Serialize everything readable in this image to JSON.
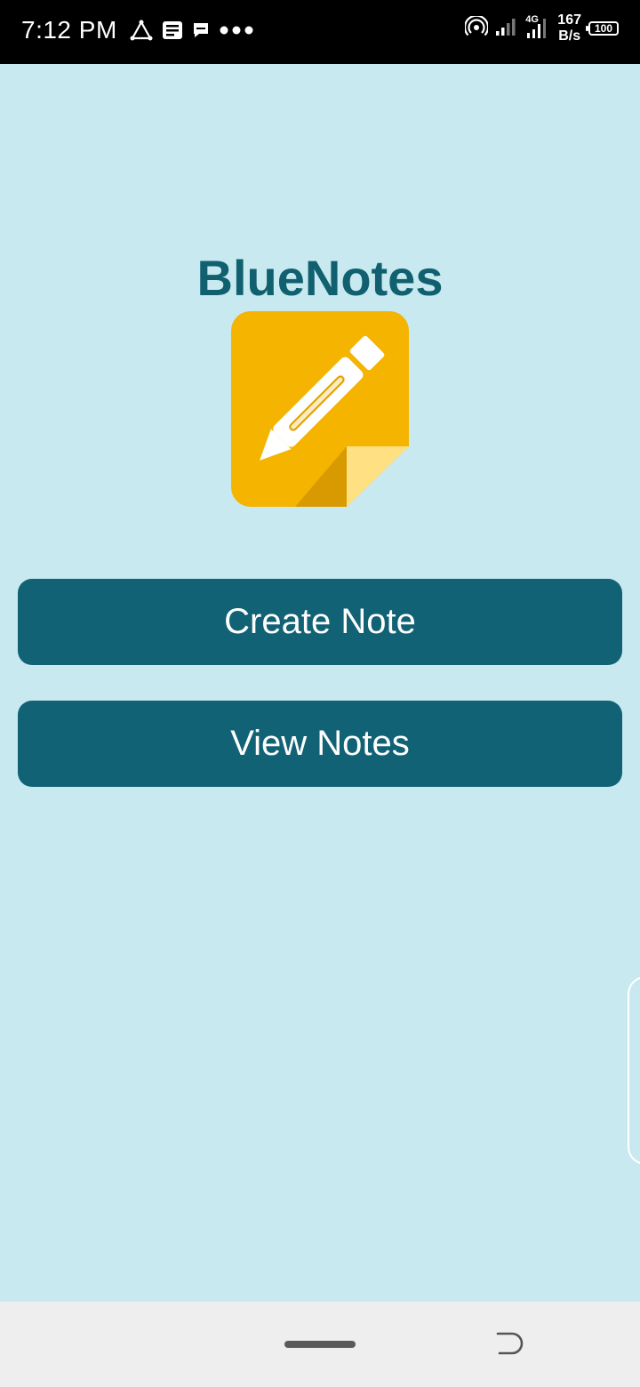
{
  "status_bar": {
    "time": "7:12 PM",
    "left_icons": [
      "triangle-nodes-icon",
      "news-icon",
      "message-icon",
      "more-dots-icon"
    ],
    "network_type": "4G",
    "speed_value": "167",
    "speed_unit": "B/s",
    "battery": "100"
  },
  "app": {
    "title": "BlueNotes",
    "logo": "note-pencil-logo"
  },
  "buttons": {
    "create_note": "Create Note",
    "view_notes": "View Notes"
  },
  "nav_bar": {
    "home": "home-pill",
    "back": "back-icon"
  },
  "colors": {
    "background": "#c8e9f0",
    "primary": "#116275",
    "title": "#10606f",
    "logo_yellow": "#f4b400",
    "logo_fold": "#ffe082"
  }
}
